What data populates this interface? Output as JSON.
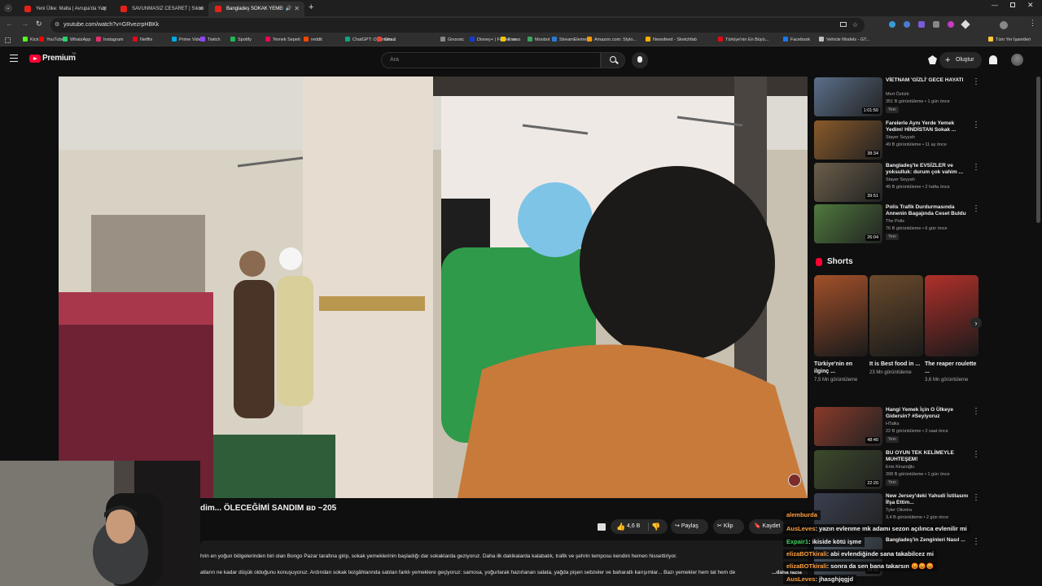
{
  "browser": {
    "tabs": [
      {
        "title": "Yeni Ülke: Malta | Avrupa'da Yaş",
        "close": "✕"
      },
      {
        "title": "SAVUNMASIZ CESARET | Sıkıdı",
        "close": "✕"
      },
      {
        "title": "Bangladeş SOKAK YEMEĞİ",
        "close": "✕",
        "audio": "🔊"
      }
    ],
    "new_tab": "+",
    "url": "youtube.com/watch?v=GRvezrpHBKk",
    "bookmarks": [
      "Kick",
      "YouTube",
      "WhatsApp",
      "Instagram",
      "Netflix",
      "Prime Video",
      "Twitch",
      "Spotify",
      "Yemek Sepeti",
      "reddit",
      "ChatGPT: Optimizin...",
      "Gmail",
      "Gnoosic",
      "Disney+ | Filmler ve...",
      "Exxen",
      "Moobot",
      "StreamElements",
      "Amazon.com: Stylo...",
      "Newsfeed - Sketchfab",
      "Türkiye'nin En Büyü...",
      "Facebook",
      "Vehicle Models - GT...",
      "Tüm Yer İşaretleri"
    ],
    "bookmark_colors": [
      "#53fc18",
      "#ff0000",
      "#25d366",
      "#e1306c",
      "#e50914",
      "#00a8e1",
      "#9146ff",
      "#1db954",
      "#fa0050",
      "#ff4500",
      "#10a37f",
      "#ea4335",
      "#888888",
      "#113ccf",
      "#f5c400",
      "#3ba55d",
      "#2a7bd4",
      "#ff9900",
      "#ffae00",
      "#e30a17",
      "#1877f2",
      "#c0c0c0",
      "#ffc83d"
    ]
  },
  "youtube": {
    "logo_text": "Premium",
    "logo_sup": "TR",
    "search_placeholder": "Ara",
    "create_label": "Oluştur",
    "video_title": "dim... ÖLECEĞİMİ SANDIM ʙᴅ ~205",
    "likes": "4,6 B",
    "share_label": "Paylaş",
    "clip_label": "Klip",
    "save_label": "Kaydet",
    "description_lines": [
      "hrin en yoğun bölgelerinden biri olan Bongo Pazar tarafına girip, sokak yemeklerinin başladığı dar sokaklarda geziyoruz. Daha ilk dakikalarda kalabalık, trafik ve şehrin temposu kendini hemen hissettiriyor.",
      "atların ne kadar düşük olduğunu konuşuyoruz. Ardından sokak tezgâhlarında satılan farklı yemeklere geçiyoruz: samosa, yoğurlarak hazırlanan salata, yağda pişen sebzeler ve baharatlı karışımlar... Bazı yemekler hem tat hem de"
    ],
    "more_label": "...daha fazla"
  },
  "recommendations": [
    {
      "title": "VİETNAM 'GİZLİ' GECE HAYATI",
      "channel": "Mert Öztürk",
      "meta": "351 B görüntüleme • 1 gün önce",
      "badge": "Yeni",
      "duration": "1:01:50",
      "thumb_color": "#5b6f8a"
    },
    {
      "title": "Farelerle Aynı Yerde Yemek Yedim! HİNDİSTAN Sokak ...",
      "channel": "Stayer Seyyah",
      "meta": "49 B görüntüleme • 11 ay önce",
      "badge": "",
      "duration": "38:34",
      "thumb_color": "#8a5a2a"
    },
    {
      "title": "Bangladeş'te EVSİZLER ve yoksulluk: durum çok vahim ...",
      "channel": "Stayer Seyyah",
      "meta": "49 B görüntüleme • 2 hafta önce",
      "badge": "",
      "duration": "39:51",
      "thumb_color": "#6b5f4a"
    },
    {
      "title": "Polis Trafik Durdurmasında Annenin Bagajında Ceset Buldu",
      "channel": "The Polis",
      "meta": "76 B görüntüleme • 6 gün önce",
      "badge": "Yeni",
      "duration": "26:04",
      "thumb_color": "#4f7a3d"
    }
  ],
  "shorts_header": "Shorts",
  "shorts": [
    {
      "title": "Türkiye'nin en ilginç ...",
      "views": "7,5 Mn görüntüleme",
      "thumb_color": "#a2502a"
    },
    {
      "title": "It is Best food in ...",
      "views": "23 Mn görüntüleme",
      "thumb_color": "#6a4a2c"
    },
    {
      "title": "The reaper roulette ...",
      "views": "3,6 Mn görüntüleme",
      "thumb_color": "#b0302a"
    }
  ],
  "recommendations2": [
    {
      "title": "Hangi Yemek İçin O Ülkeye Gidersin? #Seyiyoruz",
      "channel": "HTalks",
      "meta": "22 B görüntüleme • 2 saat önce",
      "badge": "Yeni",
      "duration": "48:40",
      "thumb_color": "#8a3a2a"
    },
    {
      "title": "BU OYUN TEK KELİMEYLE MUHTEŞEM!",
      "channel": "Enis Kirazoğlu",
      "meta": "398 B görüntüleme • 1 gün önce",
      "badge": "Yeni",
      "duration": "22:20",
      "thumb_color": "#3c4a2a"
    },
    {
      "title": "New Jersey'deki Yahudi İstilasını İfşa Ettim...",
      "channel": "Tyler Oliveira",
      "meta": "3,4 B görüntüleme • 2 gün önce",
      "badge": "",
      "duration": "",
      "thumb_color": "#3a4050"
    },
    {
      "title": "Bangladeş'in Zenginleri Nasıl ...",
      "channel": "Ugur Kılıç",
      "meta": "",
      "badge": "",
      "duration": "24:10",
      "thumb_color": "#506070"
    }
  ],
  "chat": [
    {
      "user": "alemburda",
      "text": "",
      "color": "#ff9e3d"
    },
    {
      "user": "AusLeves",
      "text": ": yazın evlenme mk adamı sezon açılınca evlenilir mi",
      "color": "#ff9e3d"
    },
    {
      "user": "Expair1",
      "text": ": ikiside kötü işme",
      "color": "#3dcf5e"
    },
    {
      "user": "elizaBOTkirali",
      "text": ": abi evlendiğinde sana takabilcez mi",
      "color": "#ff9e3d"
    },
    {
      "user": "elizaBOTkirali",
      "text": ": sonra da sen bana takarsın 😡😡😡",
      "color": "#ff9e3d"
    },
    {
      "user": "AusLeves",
      "text": ": jhasghjqgjd",
      "color": "#ff9e3d"
    }
  ],
  "colors": {
    "brand_red": "#ff0033",
    "bg": "#0f0f0f"
  }
}
